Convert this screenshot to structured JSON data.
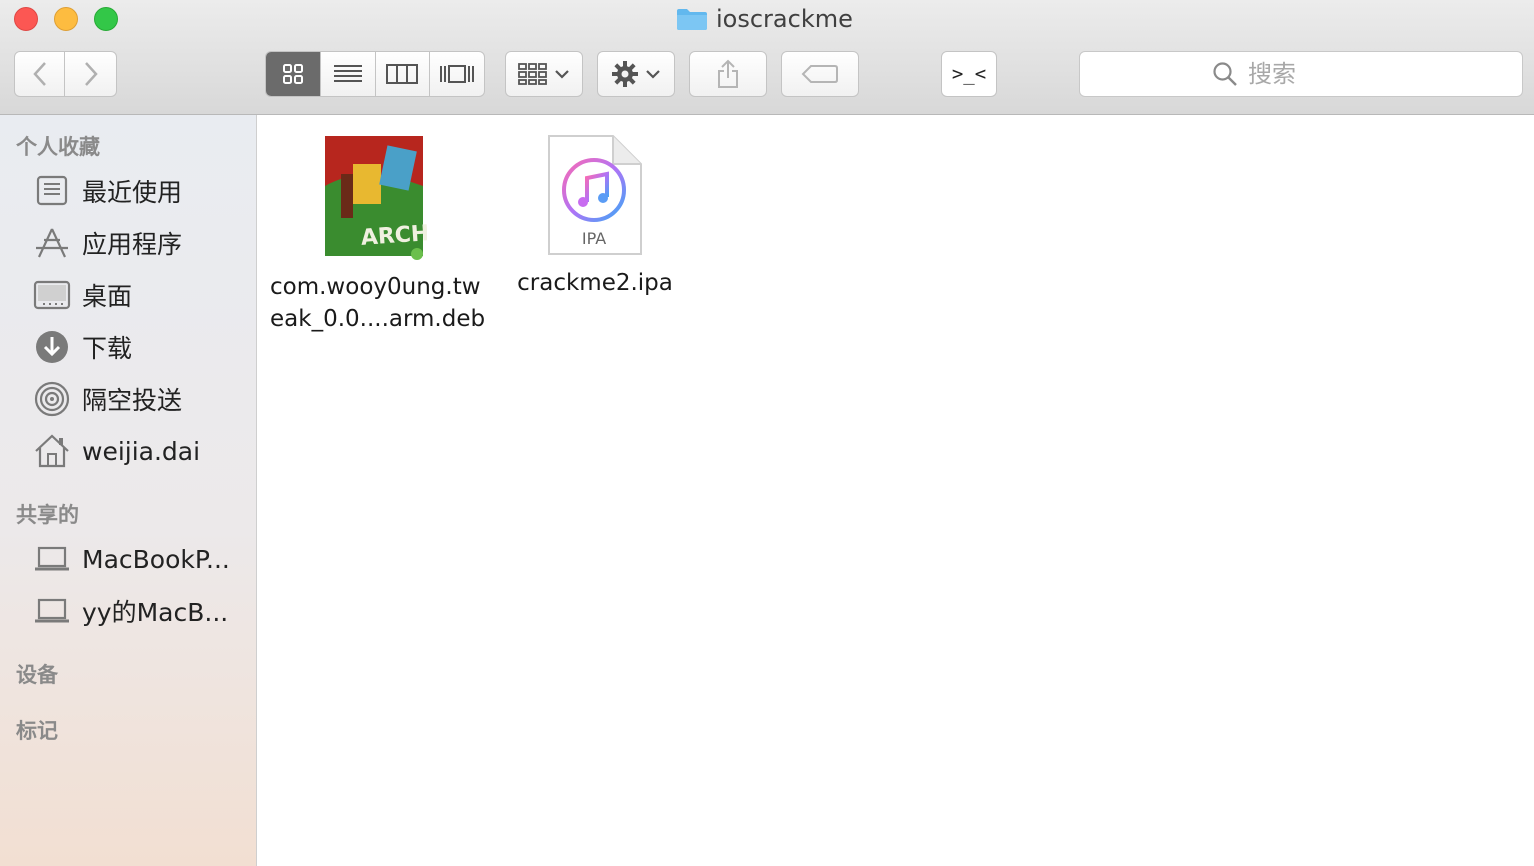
{
  "window": {
    "title": "ioscrackme"
  },
  "toolbar": {
    "back_icon": "chevron-left-icon",
    "forward_icon": "chevron-right-icon",
    "view_modes": [
      "icon-view",
      "list-view",
      "column-view",
      "cover-flow-view"
    ],
    "active_view": "icon-view",
    "terminal_label": ">_<",
    "search_placeholder": "搜索"
  },
  "sidebar": {
    "favorites_title": "个人收藏",
    "favorites": [
      {
        "label": "最近使用",
        "icon": "recents-icon"
      },
      {
        "label": "应用程序",
        "icon": "applications-icon"
      },
      {
        "label": "桌面",
        "icon": "desktop-icon"
      },
      {
        "label": "下载",
        "icon": "downloads-icon"
      },
      {
        "label": "隔空投送",
        "icon": "airdrop-icon"
      },
      {
        "label": "weijia.dai",
        "icon": "home-icon"
      }
    ],
    "shared_title": "共享的",
    "shared": [
      {
        "label": "MacBookP...",
        "icon": "laptop-icon"
      },
      {
        "label": "yy的MacB...",
        "icon": "laptop-icon"
      }
    ],
    "devices_title": "设备",
    "tags_title": "标记"
  },
  "files": [
    {
      "name_line1": "com.wooy0ung.tw",
      "name_line2": "eak_0.0....arm.deb",
      "icon": "archive-icon",
      "badge": "ARCHIVE"
    },
    {
      "name_line1": "crackme2.ipa",
      "name_line2": "",
      "icon": "ipa-file-icon",
      "badge": "IPA"
    }
  ],
  "colors": {
    "close": "#fc5753",
    "minimize": "#fdbc40",
    "zoom": "#33c748",
    "folder_blue": "#62b8ee"
  }
}
